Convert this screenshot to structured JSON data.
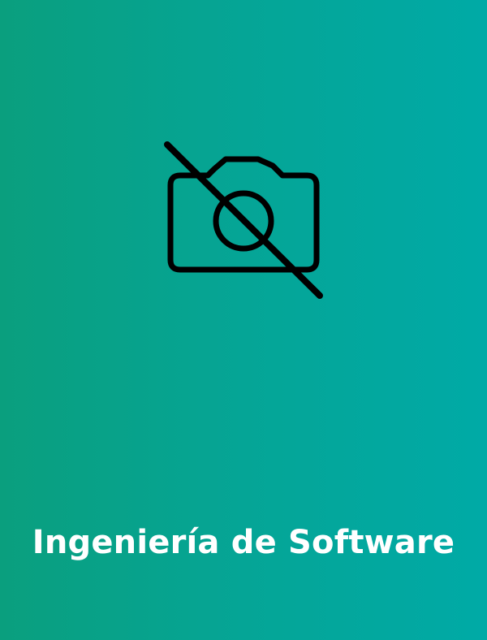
{
  "card": {
    "title": "Ingeniería de Software",
    "icon": "camera-off-icon",
    "colors": {
      "gradient_start": "#0a9f7e",
      "gradient_end": "#00aaa6",
      "icon": "#000000",
      "title": "#ffffff"
    }
  }
}
